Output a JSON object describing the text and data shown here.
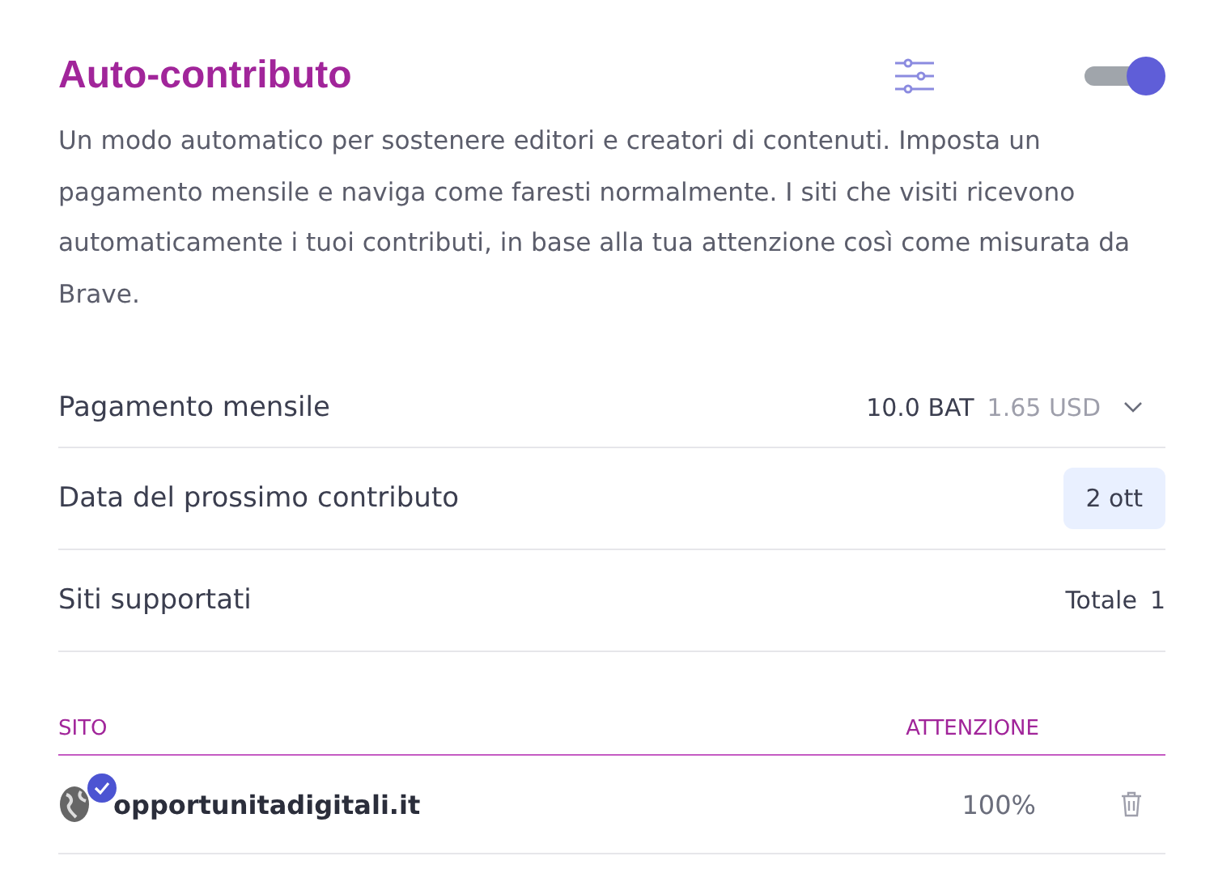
{
  "header": {
    "title": "Auto-contributo",
    "enabled": true
  },
  "description": "Un modo automatico per sostenere editori e creatori di contenuti. Imposta un pagamento mensile e naviga come faresti normalmente. I siti che visiti ricevono automaticamente i tuoi contributi, in base alla tua attenzione così come misurata da Brave.",
  "settings": [
    {
      "kind": "dropdown",
      "label": "Pagamento mensile",
      "value": "10.0 BAT",
      "secondary": "1.65 USD"
    },
    {
      "kind": "chip",
      "label": "Data del prossimo contributo",
      "value": "2 ott"
    },
    {
      "kind": "total",
      "label": "Siti supportati",
      "value": "Totale",
      "count": "1"
    }
  ],
  "table": {
    "columns": [
      "SITO",
      "ATTENZIONE"
    ],
    "rows": [
      {
        "site": "opportunitadigitali.it",
        "verified": true,
        "attention": "100%"
      }
    ]
  }
}
